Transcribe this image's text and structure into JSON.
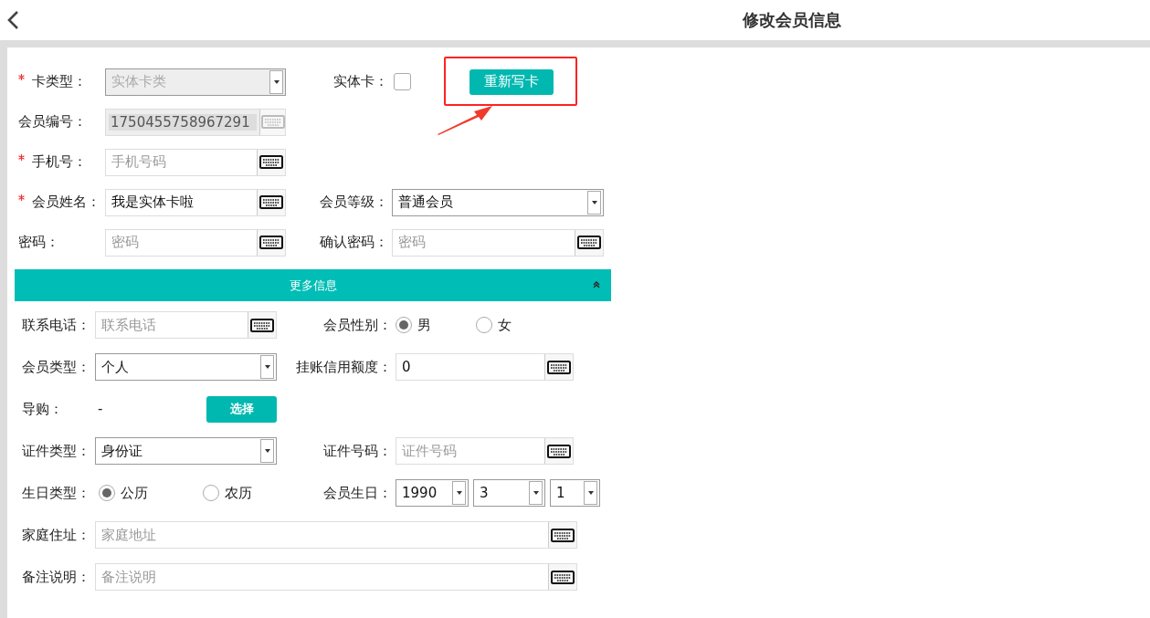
{
  "header": {
    "title": "修改会员信息"
  },
  "basic_rows": [
    {
      "items": [
        {
          "kind": "select",
          "label": "卡类型：",
          "required": true,
          "value": "实体卡类",
          "disabled": true
        },
        {
          "kind": "checkbox",
          "label": "实体卡：",
          "checked": false
        },
        {
          "kind": "button",
          "text": "重新写卡",
          "highlighted": true
        }
      ]
    },
    {
      "items": [
        {
          "kind": "input",
          "label": "会员编号：",
          "value": "1750455758967291",
          "disabled": true
        }
      ]
    },
    {
      "items": [
        {
          "kind": "input",
          "label": "手机号：",
          "required": true,
          "placeholder": "手机号码"
        }
      ]
    },
    {
      "items": [
        {
          "kind": "input",
          "label": "会员姓名：",
          "required": true,
          "value": "我是实体卡啦"
        },
        {
          "kind": "select",
          "label": "会员等级：",
          "value": "普通会员"
        }
      ]
    },
    {
      "items": [
        {
          "kind": "input",
          "label": "密码：",
          "placeholder": "密码"
        },
        {
          "kind": "input",
          "label": "确认密码：",
          "placeholder": "密码"
        }
      ]
    }
  ],
  "more_section": {
    "title": "更多信息",
    "expanded": true
  },
  "more_rows": [
    {
      "items": [
        {
          "kind": "input",
          "label": "联系电话：",
          "placeholder": "联系电话"
        },
        {
          "kind": "radio",
          "label": "会员性别：",
          "options": [
            {
              "label": "男",
              "selected": true
            },
            {
              "label": "女",
              "selected": false
            }
          ]
        }
      ]
    },
    {
      "items": [
        {
          "kind": "select",
          "label": "会员类型：",
          "value": "个人"
        },
        {
          "kind": "input",
          "label": "挂账信用额度：",
          "value": "0"
        }
      ]
    },
    {
      "items": [
        {
          "kind": "picker",
          "label": "导购：",
          "value": "-",
          "button": "选择"
        }
      ]
    },
    {
      "items": [
        {
          "kind": "select",
          "label": "证件类型：",
          "value": "身份证"
        },
        {
          "kind": "input",
          "label": "证件号码：",
          "placeholder": "证件号码"
        }
      ]
    },
    {
      "items": [
        {
          "kind": "radio",
          "label": "生日类型：",
          "options": [
            {
              "label": "公历",
              "selected": true
            },
            {
              "label": "农历",
              "selected": false
            }
          ]
        },
        {
          "kind": "date",
          "label": "会员生日：",
          "values": [
            "1990",
            "3",
            "1"
          ]
        }
      ]
    },
    {
      "items": [
        {
          "kind": "long_input",
          "label": "家庭住址：",
          "placeholder": "家庭地址"
        }
      ]
    },
    {
      "items": [
        {
          "kind": "long_input",
          "label": "备注说明：",
          "placeholder": "备注说明"
        }
      ]
    }
  ]
}
